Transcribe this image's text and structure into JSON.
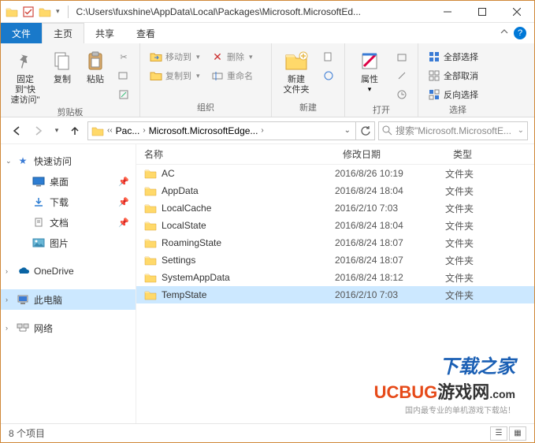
{
  "titlebar": {
    "path": "C:\\Users\\fuxshine\\AppData\\Local\\Packages\\Microsoft.MicrosoftEd..."
  },
  "tabs": {
    "file": "文件",
    "home": "主页",
    "share": "共享",
    "view": "查看"
  },
  "ribbon": {
    "clipboard": {
      "label": "剪贴板",
      "pin": "固定到\"快\n速访问\"",
      "copy": "复制",
      "paste": "粘贴"
    },
    "organize": {
      "label": "组织",
      "moveto": "移动到",
      "copyto": "复制到",
      "delete": "删除",
      "rename": "重命名"
    },
    "new": {
      "label": "新建",
      "newfolder": "新建\n文件夹"
    },
    "open": {
      "label": "打开",
      "properties": "属性"
    },
    "select": {
      "label": "选择",
      "selectall": "全部选择",
      "selectnone": "全部取消",
      "invert": "反向选择"
    }
  },
  "breadcrumb": {
    "seg1": "Pac...",
    "seg2": "Microsoft.MicrosoftEdge..."
  },
  "search": {
    "placeholder": "搜索\"Microsoft.MicrosoftE..."
  },
  "sidebar": {
    "quickaccess": "快速访问",
    "desktop": "桌面",
    "downloads": "下载",
    "documents": "文档",
    "pictures": "图片",
    "onedrive": "OneDrive",
    "thispc": "此电脑",
    "network": "网络"
  },
  "columns": {
    "name": "名称",
    "date": "修改日期",
    "type": "类型"
  },
  "files": [
    {
      "name": "AC",
      "date": "2016/8/26 10:19",
      "type": "文件夹"
    },
    {
      "name": "AppData",
      "date": "2016/8/24 18:04",
      "type": "文件夹"
    },
    {
      "name": "LocalCache",
      "date": "2016/2/10 7:03",
      "type": "文件夹"
    },
    {
      "name": "LocalState",
      "date": "2016/8/24 18:04",
      "type": "文件夹"
    },
    {
      "name": "RoamingState",
      "date": "2016/8/24 18:07",
      "type": "文件夹"
    },
    {
      "name": "Settings",
      "date": "2016/8/24 18:07",
      "type": "文件夹"
    },
    {
      "name": "SystemAppData",
      "date": "2016/8/24 18:12",
      "type": "文件夹"
    },
    {
      "name": "TempState",
      "date": "2016/2/10 7:03",
      "type": "文件夹"
    }
  ],
  "status": {
    "count": "8 个项目"
  },
  "watermark": {
    "line1": "下载之家",
    "line2a": "UCBUG",
    "line2b": "游戏网",
    "line2c": ".com",
    "line3": "国内最专业的单机游戏下载站！"
  }
}
